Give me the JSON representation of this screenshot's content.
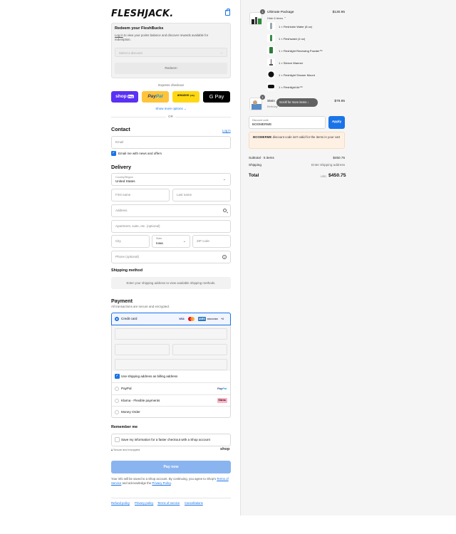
{
  "header": {
    "logo": "FLESHJACK."
  },
  "redeem": {
    "title": "Redeem your FleshBucks",
    "desc_link": "Log in",
    "desc_rest": " to view your points balance and discover rewards available for redemption.",
    "select_placeholder": "Select a discount",
    "button": "Redeem"
  },
  "express": {
    "label": "Express checkout",
    "shop": "shop",
    "shop_pay": "Pay",
    "paypal_a": "Pay",
    "paypal_b": "Pal",
    "amazon_a": "amazon",
    "amazon_b": "pay",
    "gpay": "G Pay",
    "more": "Show more options ⌄",
    "or": "OR"
  },
  "contact": {
    "title": "Contact",
    "login": "Log in",
    "email_placeholder": "Email",
    "news_label": "Email me with news and offers"
  },
  "delivery": {
    "title": "Delivery",
    "country_label": "Country/Region",
    "country_value": "United States",
    "first_name": "First name",
    "last_name": "Last name",
    "address": "Address",
    "apartment": "Apartment, suite, etc. (optional)",
    "city": "City",
    "state_label": "State",
    "state_value": "Iowa",
    "zip": "ZIP code",
    "phone": "Phone (optional)"
  },
  "shipping": {
    "title": "Shipping method",
    "message": "Enter your shipping address to view available shipping methods."
  },
  "payment": {
    "title": "Payment",
    "secure": "All transactions are secure and encrypted.",
    "credit_card": "Credit card",
    "cards": {
      "visa": "VISA",
      "amex": "AMEX",
      "discover": "DISCOVER",
      "more": "+4"
    },
    "billing_label": "Use shipping address as billing address",
    "paypal": "PayPal",
    "paypal_logo_a": "Pay",
    "paypal_logo_b": "Pal",
    "klarna": "Klarna - Flexible payments",
    "klarna_logo": "Klarna.",
    "money_order": "Money Order"
  },
  "remember": {
    "title": "Remember me",
    "label": "Save my information for a faster checkout with a Shop account",
    "secure": "Secure and encrypted",
    "shop": "shop"
  },
  "pay_now": "Pay now",
  "legal": {
    "text1": "Your info will be saved to a Shop account. By continuing, you agree to Shop's ",
    "terms": "Terms of Service",
    "text2": " and acknowledge the ",
    "privacy": "Privacy Policy",
    "text3": "."
  },
  "footer": [
    "Refund policy",
    "Privacy policy",
    "Terms of service",
    "Cancellations"
  ],
  "cart": {
    "package": {
      "qty": "1",
      "name": "Ultimate Package",
      "toggle": "Hide 6 items ⌃",
      "price": "$130.95",
      "items": [
        "1 × Fleshlube Water (8 oz)",
        "1 × Fleshwash (4 oz)",
        "1 × Fleshlight Renewing Powder™",
        "1 × Sleeve Warmer",
        "1 × Fleshlight Shower Mount",
        "1 × Fleshlight Air™"
      ]
    },
    "second": {
      "qty": "1",
      "name": "Stein",
      "sub": "Birthday",
      "price": "$79.95"
    },
    "scroll_pill": "Scroll for more items ↓",
    "discount_label": "Discount code",
    "discount_value": "BOOMERME",
    "apply": "Apply",
    "warning_code": "BOOMERME",
    "warning_rest": " discount code isn't valid for the items in your cart",
    "subtotal_label": "Subtotal · 5 items",
    "subtotal": "$450.75",
    "shipping_label": "Shipping",
    "shipping_value": "Enter shipping address",
    "total_label": "Total",
    "currency": "USD",
    "total": "$450.75"
  },
  "colors": {
    "accent": "#1a73e8",
    "shop_purple": "#5a31f4",
    "paypal_yellow": "#ffc439",
    "amazon_yellow": "#ffd814"
  }
}
